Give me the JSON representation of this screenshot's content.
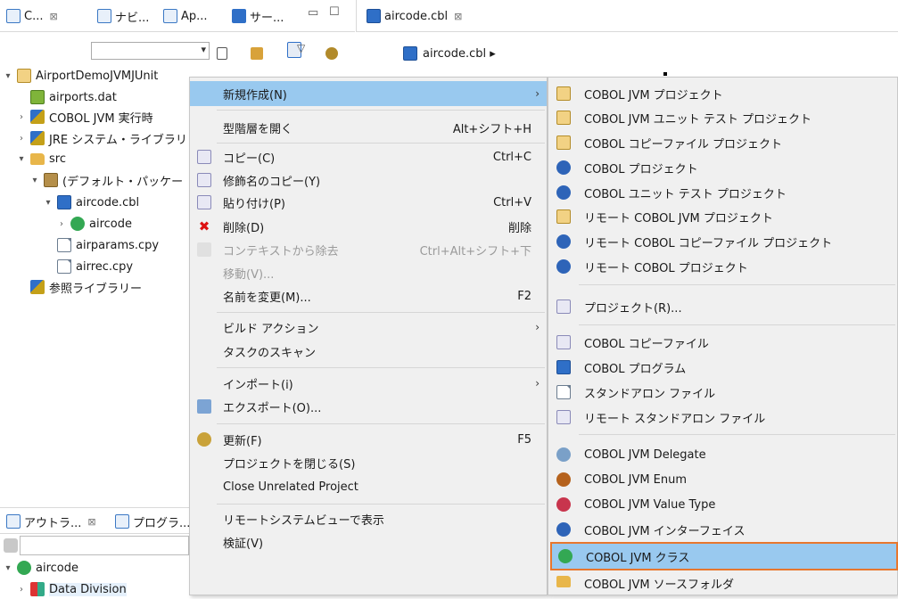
{
  "explorer": {
    "tabs": [
      {
        "label": "C...",
        "close": "⊠"
      },
      {
        "label": "ナビ..."
      },
      {
        "label": "Ap..."
      },
      {
        "label": "サー..."
      }
    ],
    "tree": [
      {
        "label": "AirportDemoJVMJUnit"
      },
      {
        "label": "airports.dat"
      },
      {
        "label": "COBOL JVM 実行時"
      },
      {
        "label": "JRE システム・ライブラリ"
      },
      {
        "label": "src"
      },
      {
        "label": "(デフォルト・パッケー"
      },
      {
        "label": "aircode.cbl"
      },
      {
        "label": "aircode"
      },
      {
        "label": "airparams.cpy"
      },
      {
        "label": "airrec.cpy"
      },
      {
        "label": "参照ライブラリー"
      }
    ]
  },
  "outline": {
    "tabs": [
      {
        "label": "アウトラ...",
        "close": "⊠"
      },
      {
        "label": "プログラ..."
      }
    ],
    "tree": [
      {
        "label": "aircode"
      },
      {
        "label": "Data Division"
      }
    ]
  },
  "editor": {
    "tab_label": "aircode.cbl",
    "tab_close": "⊠",
    "breadcrumb": "aircode.cbl ▸"
  },
  "context_menu": {
    "items": [
      {
        "label": "新規作成(N)",
        "submenu": "›"
      },
      {
        "label": "型階層を開く",
        "shortcut": "Alt+シフト+H"
      },
      {
        "label": "コピー(C)",
        "shortcut": "Ctrl+C"
      },
      {
        "label": "修飾名のコピー(Y)"
      },
      {
        "label": "貼り付け(P)",
        "shortcut": "Ctrl+V"
      },
      {
        "label": "削除(D)",
        "shortcut": "削除"
      },
      {
        "label": "コンテキストから除去",
        "shortcut": "Ctrl+Alt+シフト+下"
      },
      {
        "label": "移動(V)..."
      },
      {
        "label": "名前を変更(M)...",
        "shortcut": "F2"
      },
      {
        "label": "ビルド アクション",
        "submenu": "›"
      },
      {
        "label": "タスクのスキャン"
      },
      {
        "label": "インポート(i)",
        "submenu": "›"
      },
      {
        "label": "エクスポート(O)..."
      },
      {
        "label": "更新(F)",
        "shortcut": "F5"
      },
      {
        "label": "プロジェクトを閉じる(S)"
      },
      {
        "label": "Close Unrelated Project"
      },
      {
        "label": "リモートシステムビューで表示"
      },
      {
        "label": "検証(V)"
      }
    ]
  },
  "submenu": {
    "items": [
      {
        "label": "COBOL JVM プロジェクト"
      },
      {
        "label": "COBOL JVM ユニット テスト プロジェクト"
      },
      {
        "label": "COBOL コピーファイル プロジェクト"
      },
      {
        "label": "COBOL プロジェクト"
      },
      {
        "label": "COBOL ユニット テスト プロジェクト"
      },
      {
        "label": "リモート COBOL JVM プロジェクト"
      },
      {
        "label": "リモート COBOL コピーファイル プロジェクト"
      },
      {
        "label": "リモート COBOL プロジェクト"
      },
      {
        "label": "プロジェクト(R)..."
      },
      {
        "label": "COBOL コピーファイル"
      },
      {
        "label": "COBOL プログラム"
      },
      {
        "label": "スタンドアロン ファイル"
      },
      {
        "label": "リモート スタンドアロン ファイル"
      },
      {
        "label": "COBOL JVM Delegate"
      },
      {
        "label": "COBOL JVM Enum"
      },
      {
        "label": "COBOL JVM Value Type"
      },
      {
        "label": "COBOL JVM インターフェイス"
      },
      {
        "label": "COBOL JVM クラス"
      },
      {
        "label": "COBOL JVM ソースフォルダ"
      }
    ],
    "highlight_color": "#99c9ef",
    "focus_border_color": "#e8772e"
  }
}
